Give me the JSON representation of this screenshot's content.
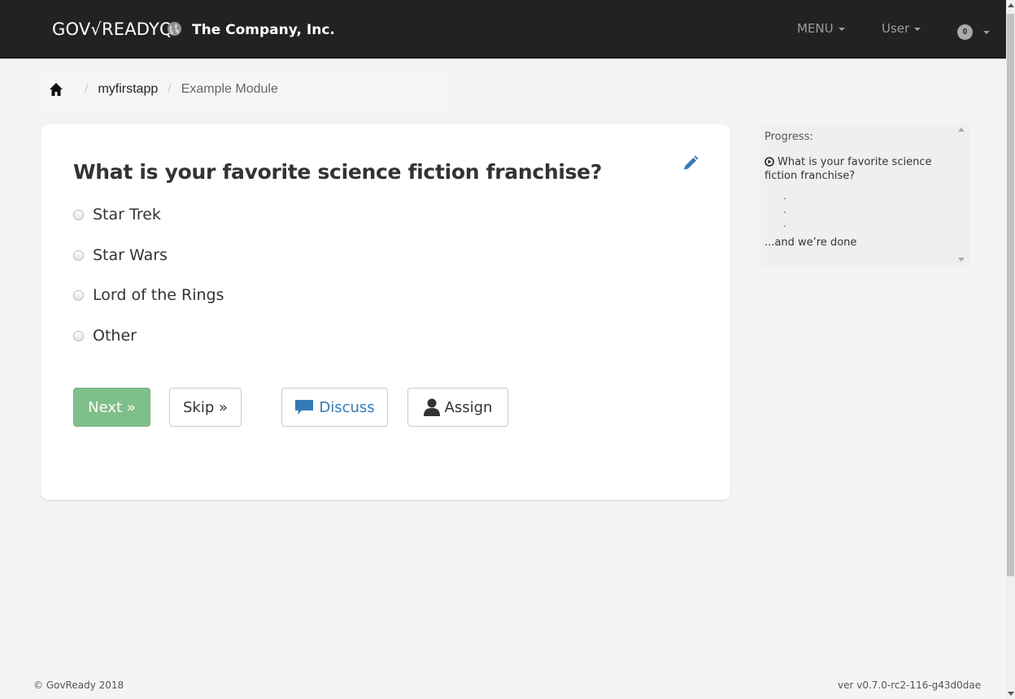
{
  "navbar": {
    "brand": "GOV√READYQ",
    "organization": "The Company, Inc.",
    "menu_label": "MENU",
    "user_label": "User",
    "notification_count": "0",
    "globe_icon": "globe-icon"
  },
  "breadcrumb": {
    "home_icon": "home-icon",
    "items": [
      {
        "label": "myfirstapp"
      },
      {
        "label": "Example Module"
      }
    ]
  },
  "question": {
    "title": "What is your favorite science fiction franchise?",
    "edit_icon": "pencil-icon",
    "choices": [
      {
        "label": "Star Trek",
        "selected": false
      },
      {
        "label": "Star Wars",
        "selected": false
      },
      {
        "label": "Lord of the Rings",
        "selected": false
      },
      {
        "label": "Other",
        "selected": false
      }
    ]
  },
  "buttons": {
    "next": "Next »",
    "skip": "Skip »",
    "discuss": "Discuss",
    "assign": "Assign"
  },
  "progress": {
    "label": "Progress:",
    "current": "What is your favorite science fiction franchise?",
    "done": "...and we’re done"
  },
  "footer": {
    "copyright": "© GovReady 2018",
    "version": "ver v0.7.0-rc2-116-g43d0dae"
  },
  "colors": {
    "navbar_bg": "#222222",
    "next_button": "#7fc08a",
    "link_blue": "#337ab7",
    "page_bg": "#f4f4f4"
  }
}
